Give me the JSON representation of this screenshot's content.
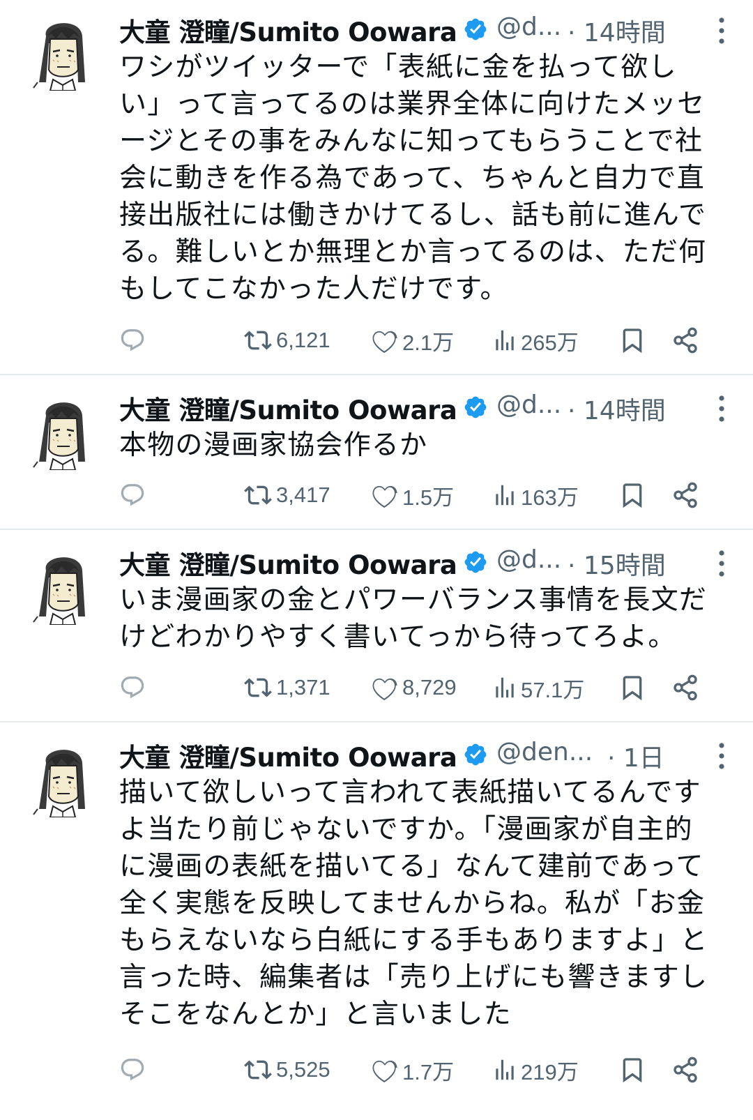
{
  "tweets": [
    {
      "name": "大童 澄瞳/Sumito Oowara",
      "handle": "@d...",
      "time": "· 14時間",
      "text": "ワシがツイッターで「表紙に金を払って欲し\nい」って言ってるのは業界全体に向けたメッセ\nージとその事をみんなに知ってもらうことで社\n会に動きを作る為であって、ちゃんと自力で直\n接出版社には働きかけてるし、話も前に進んで\nる。難しいとか無理とか言ってるのは、ただ何\nもしてこなかった人だけです。",
      "retweets": "6,121",
      "likes": "2.1万",
      "views": "265万"
    },
    {
      "name": "大童 澄瞳/Sumito Oowara",
      "handle": "@d...",
      "time": "· 14時間",
      "text": "本物の漫画家協会作るか",
      "retweets": "3,417",
      "likes": "1.5万",
      "views": "163万"
    },
    {
      "name": "大童 澄瞳/Sumito Oowara",
      "handle": "@d...",
      "time": "· 15時間",
      "text": "いま漫画家の金とパワーバランス事情を長文だ\nけどわかりやすく書いてっから待ってろよ。",
      "retweets": "1,371",
      "likes": "8,729",
      "views": "57.1万"
    },
    {
      "name": "大童 澄瞳/Sumito Oowara",
      "handle": "@den...",
      "time": "· 1日",
      "text": "描いて欲しいって言われて表紙描いてるんです\nよ当たり前じゃないですか。「漫画家が自主的\nに漫画の表紙を描いてる」なんて建前であって\n全く実態を反映してませんからね。私が「お金\nもらえないなら白紙にする手もありますよ」と\n言った時、編集者は「売り上げにも響きますし\nそこをなんとか」と言いました",
      "retweets": "5,525",
      "likes": "1.7万",
      "views": "219万"
    }
  ],
  "colors": {
    "text": "#0f1419",
    "muted": "#536471",
    "verified": "#1d9bf0",
    "divider": "#e6e9eb"
  },
  "icons": [
    "avatar",
    "verified-badge-icon",
    "more-icon",
    "reply-icon",
    "retweet-icon",
    "like-icon",
    "views-icon",
    "bookmark-icon",
    "share-icon"
  ]
}
